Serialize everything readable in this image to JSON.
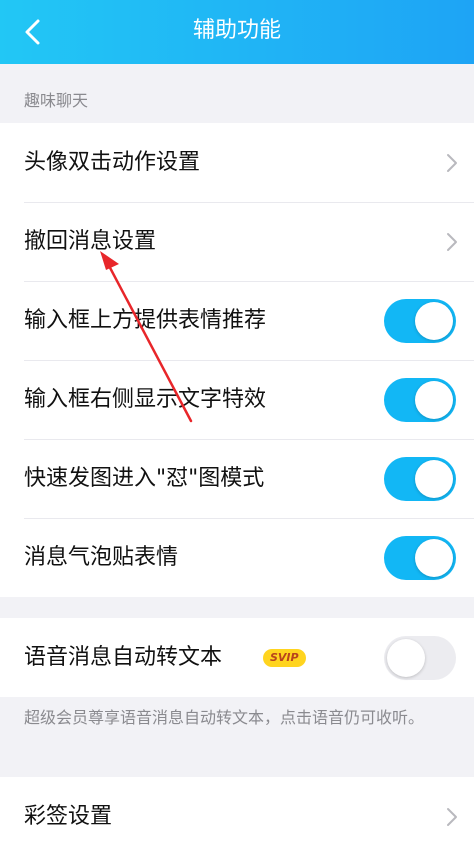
{
  "header": {
    "title": "辅助功能"
  },
  "section": {
    "label": "趣味聊天"
  },
  "items": [
    {
      "label": "头像双击动作设置"
    },
    {
      "label": "撤回消息设置"
    },
    {
      "label": "输入框上方提供表情推荐",
      "enabled": true
    },
    {
      "label": "输入框右侧显示文字特效",
      "enabled": true
    },
    {
      "label": "快速发图进入\"怼\"图模式",
      "enabled": true
    },
    {
      "label": "消息气泡贴表情",
      "enabled": true
    }
  ],
  "voice": {
    "label": "语音消息自动转文本",
    "badge": "SVIP",
    "enabled": false
  },
  "note": "超级会员尊享语音消息自动转文本，点击语音仍可收听。",
  "caiqian": {
    "label": "彩签设置"
  },
  "colors": {
    "accent": "#12b7f5",
    "header_start": "#22c7f5",
    "header_end": "#1ea4f5",
    "annotation_arrow": "#e8262a"
  }
}
